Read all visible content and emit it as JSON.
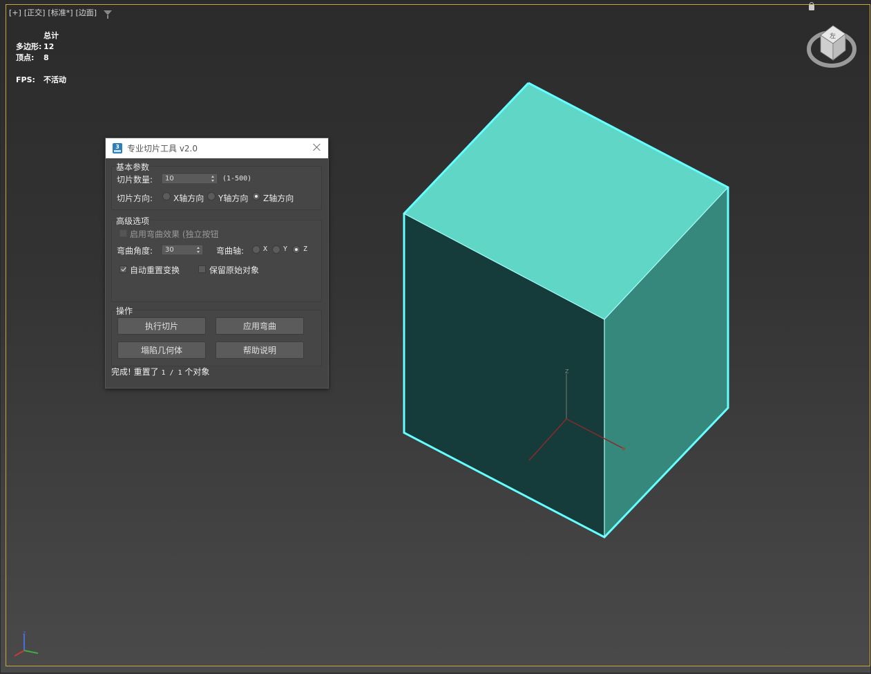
{
  "viewport": {
    "label_parts": [
      "[+]",
      "[正交]",
      "[标准*]",
      "[边面]"
    ],
    "stats": {
      "header": "总计",
      "polygons_label": "多边形:",
      "polygons_value": "12",
      "vertices_label": "顶点:",
      "vertices_value": "8",
      "fps_label": "FPS:",
      "fps_value": "不活动"
    },
    "viewcube_face": "左",
    "object_colors": {
      "top": "#5fd6c6",
      "front": "#153c3a",
      "right": "#37887c",
      "selection": "#66ffff"
    },
    "gizmo_axis_z": "Z"
  },
  "dialog": {
    "title": "专业切片工具 v2.0",
    "basic_group": {
      "title": "基本参数",
      "slice_count_label": "切片数量:",
      "slice_count_value": "10",
      "slice_count_range": "(1-500)",
      "direction_label": "切片方向:",
      "directions": [
        "X轴方向",
        "Y轴方向",
        "Z轴方向"
      ],
      "selected_direction": "Z轴方向"
    },
    "advanced_group": {
      "title": "高级选项",
      "bend_enable_label": "启用弯曲效果 (独立按钮",
      "bend_angle_label": "弯曲角度:",
      "bend_angle_value": "30",
      "bend_axis_label": "弯曲轴:",
      "bend_axes": [
        "X",
        "Y",
        "Z"
      ],
      "selected_bend_axis": "Z",
      "auto_reset_label": "自动重置变换",
      "auto_reset_checked": true,
      "keep_original_label": "保留原始对象",
      "keep_original_checked": false
    },
    "actions_group": {
      "title": "操作",
      "run_slice": "执行切片",
      "apply_bend": "应用弯曲",
      "collapse": "塌陷几何体",
      "help": "帮助说明"
    },
    "status": {
      "prefix": "完成! 重置了",
      "count": "1 / 1",
      "suffix": "个对象"
    }
  }
}
